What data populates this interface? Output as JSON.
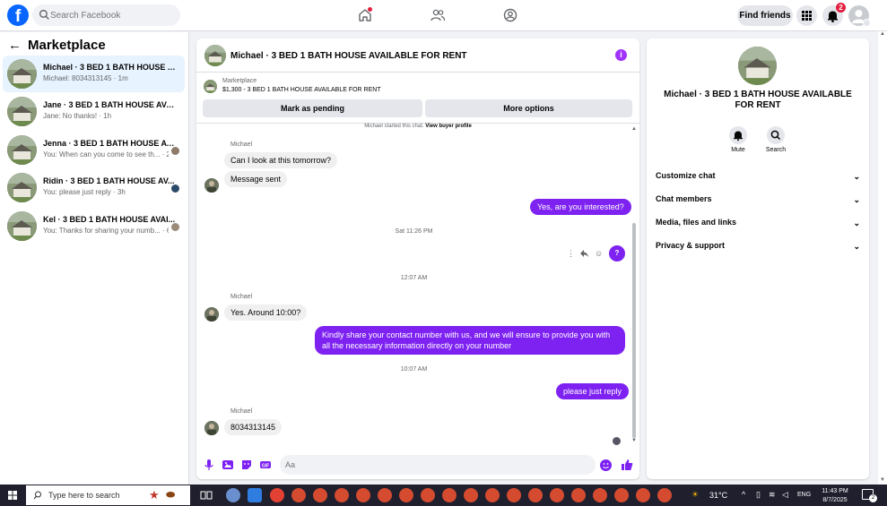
{
  "topbar": {
    "logo": "f",
    "search_placeholder": "Search Facebook",
    "find_friends": "Find friends",
    "notification_count": "2",
    "icons": [
      "facebook-logo",
      "search-icon",
      "home-icon",
      "friends-icon",
      "groups-icon",
      "menu-grid-icon",
      "bell-icon",
      "profile-avatar"
    ]
  },
  "sidebar": {
    "back_glyph": "←",
    "title": "Marketplace",
    "conversations": [
      {
        "name": "Michael · 3 BED 1 BATH HOUSE AV...",
        "snippet": "Michael: 8034313145 · 1m",
        "active": true
      },
      {
        "name": "Jane · 3 BED 1 BATH HOUSE AVAIL...",
        "snippet": "Jane: No thanks! · 1h",
        "active": false
      },
      {
        "name": "Jenna · 3 BED 1 BATH HOUSE AV...",
        "snippet": "You: When can you come to see th... · 2h",
        "active": false
      },
      {
        "name": "Ridin · 3 BED 1 BATH HOUSE AV...",
        "snippet": "You: please just reply · 3h",
        "active": false
      },
      {
        "name": "Kel · 3 BED 1 BATH HOUSE AVAI...",
        "snippet": "You: Thanks for sharing your numb... · 6h",
        "active": false
      }
    ]
  },
  "chat": {
    "title": "Michael · 3 BED 1 BATH HOUSE AVAILABLE FOR RENT",
    "info_glyph": "i",
    "marketplace_label": "Marketplace",
    "listing": "$1,300 - 3 BED 1 BATH HOUSE AVAILABLE FOR RENT",
    "mark_pending": "Mark as pending",
    "more_options": "More options",
    "started_text": "Michael started this chat.",
    "view_buyer": "View buyer profile",
    "messages": {
      "sender1": "Michael",
      "m1": "Can I look at this tomorrow?",
      "m2": "Message sent",
      "m3": "Yes, are you interested?",
      "ts1": "Sat 11:26 PM",
      "q": "?",
      "ts2": "12:07 AM",
      "sender2": "Michael",
      "m4": "Yes. Around 10:00?",
      "m5": "Kindly share your contact number with us, and we will ensure to provide you with all the necessary information directly on your number",
      "ts3": "10:07 AM",
      "m6": "please just reply",
      "sender3": "Michael",
      "m7": "8034313145"
    },
    "composer_placeholder": "Aa"
  },
  "right_panel": {
    "title": "Michael · 3 BED 1 BATH HOUSE AVAILABLE FOR RENT",
    "mute": "Mute",
    "search": "Search",
    "rows": [
      "Customize chat",
      "Chat members",
      "Media, files and links",
      "Privacy & support"
    ]
  },
  "taskbar": {
    "search_placeholder": "Type here to search",
    "temperature": "31°C",
    "language": "ENG",
    "time": "11:43 PM",
    "date": "8/7/2025",
    "notification_count": "2"
  },
  "colors": {
    "facebook_blue": "#0866ff",
    "messenger_purple": "#7e22f2",
    "notification_red": "#e41e3f"
  }
}
